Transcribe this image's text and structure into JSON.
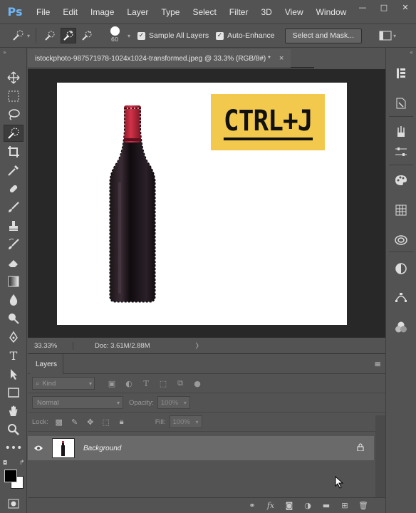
{
  "app": {
    "logo": "Ps"
  },
  "menu": [
    "File",
    "Edit",
    "Image",
    "Layer",
    "Type",
    "Select",
    "Filter",
    "3D",
    "View",
    "Window"
  ],
  "window_controls": {
    "minimize": "—",
    "maximize": "□",
    "close": "✕"
  },
  "options": {
    "brush_size": "60",
    "sample_all_layers": {
      "label": "Sample All Layers",
      "checked": true
    },
    "auto_enhance": {
      "label": "Auto-Enhance",
      "checked": true
    },
    "select_and_mask": "Select and Mask..."
  },
  "document": {
    "tab_title": "istockphoto-987571978-1024x1024-transformed.jpeg @ 33.3% (RGB/8#) *",
    "close": "×",
    "overlay_text": "CTRL+J",
    "overlay_bg": "#f2c94c"
  },
  "status": {
    "zoom": "33.33%",
    "doc": "Doc: 3.61M/2.88M",
    "arrow": "〉"
  },
  "layers": {
    "tab": "Layers",
    "filter": "Kind",
    "blend_mode": "Normal",
    "opacity_label": "Opacity:",
    "opacity": "100%",
    "lock_label": "Lock:",
    "fill_label": "Fill:",
    "fill": "100%",
    "items": [
      {
        "name": "Background",
        "visible": true,
        "locked": true
      }
    ],
    "footer_fx": "fx"
  },
  "colors": {
    "panel": "#535353",
    "canvas_bg": "#282828",
    "selected_layer": "#6a6a6a",
    "bottle_cap": "#c0263a"
  }
}
